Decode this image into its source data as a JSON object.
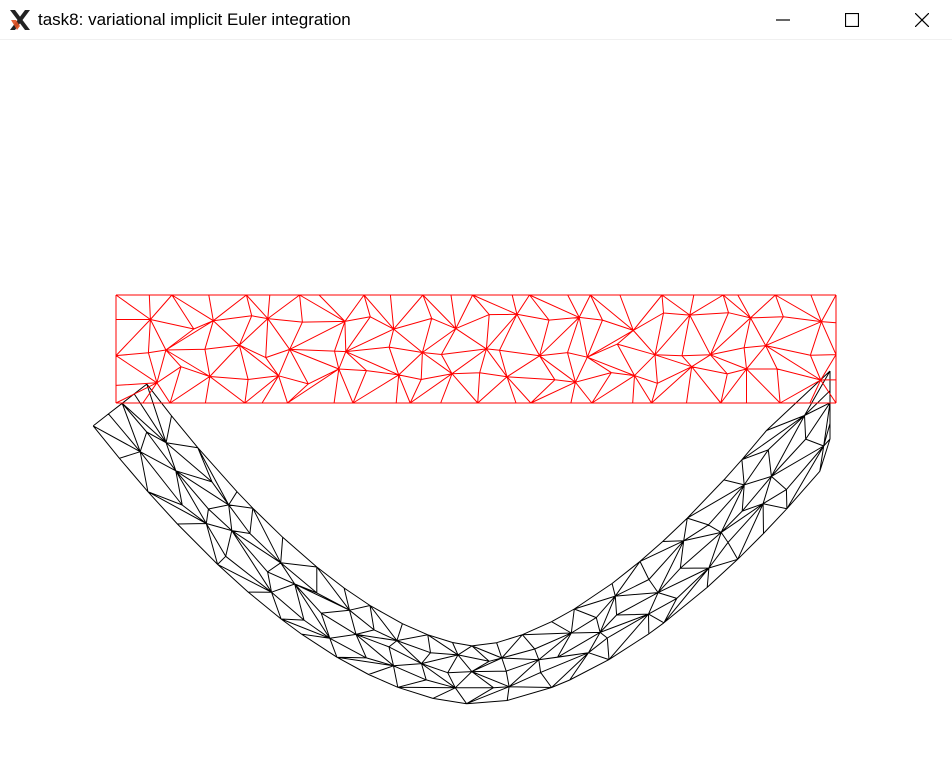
{
  "window": {
    "title": "task8: variational implicit Euler integration",
    "icon": "x-app-icon"
  },
  "controls": {
    "minimize": "minimize-icon",
    "maximize": "maximize-icon",
    "close": "close-icon"
  },
  "colors": {
    "rest_mesh": "#ff0000",
    "deformed_mesh": "#000000",
    "background": "#ffffff"
  }
}
